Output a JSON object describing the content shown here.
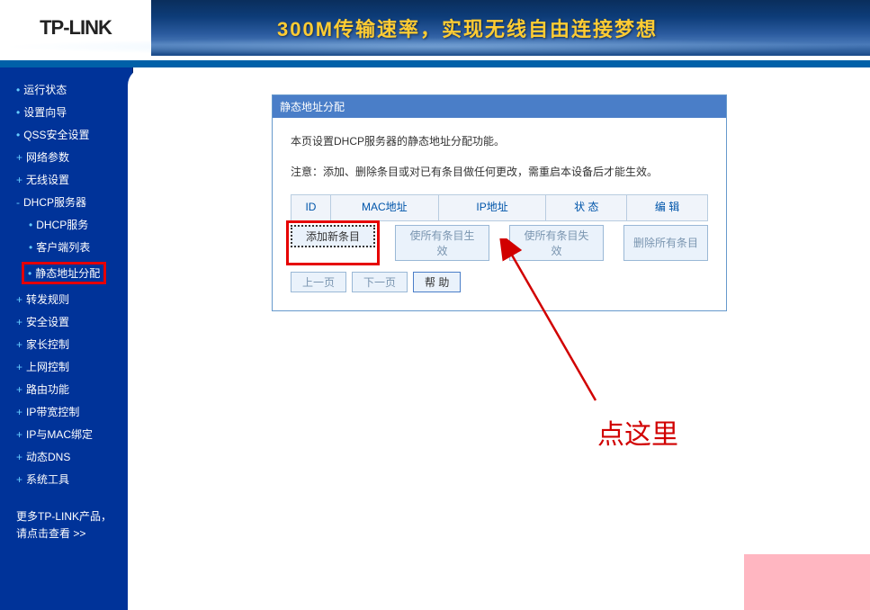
{
  "brand": "TP-LINK",
  "banner": "300M传输速率，实现无线自由连接梦想",
  "sidebar": {
    "items": [
      {
        "bullet": "•",
        "label": "运行状态"
      },
      {
        "bullet": "•",
        "label": "设置向导"
      },
      {
        "bullet": "•",
        "label": "QSS安全设置"
      },
      {
        "bullet": "+",
        "label": "网络参数"
      },
      {
        "bullet": "+",
        "label": "无线设置"
      },
      {
        "bullet": "-",
        "label": "DHCP服务器"
      }
    ],
    "subitems": [
      {
        "bullet": "•",
        "label": "DHCP服务"
      },
      {
        "bullet": "•",
        "label": "客户端列表"
      },
      {
        "bullet": "•",
        "label": "静态地址分配"
      }
    ],
    "items2": [
      {
        "bullet": "+",
        "label": "转发规则"
      },
      {
        "bullet": "+",
        "label": "安全设置"
      },
      {
        "bullet": "+",
        "label": "家长控制"
      },
      {
        "bullet": "+",
        "label": "上网控制"
      },
      {
        "bullet": "+",
        "label": "路由功能"
      },
      {
        "bullet": "+",
        "label": "IP带宽控制"
      },
      {
        "bullet": "+",
        "label": "IP与MAC绑定"
      },
      {
        "bullet": "+",
        "label": "动态DNS"
      },
      {
        "bullet": "+",
        "label": "系统工具"
      }
    ],
    "footer1": "更多TP-LINK产品，",
    "footer2": "请点击查看 >>"
  },
  "panel": {
    "title": "静态地址分配",
    "desc": "本页设置DHCP服务器的静态地址分配功能。",
    "note": "注意：添加、删除条目或对已有条目做任何更改，需重启本设备后才能生效。",
    "headers": [
      "ID",
      "MAC地址",
      "IP地址",
      "状 态",
      "编 辑"
    ],
    "buttons": {
      "add": "添加新条目",
      "enable_all": "使所有条目生效",
      "disable_all": "使所有条目失效",
      "delete_all": "删除所有条目"
    },
    "nav": {
      "prev": "上一页",
      "next": "下一页",
      "help": "帮 助"
    }
  },
  "annotation": "点这里"
}
